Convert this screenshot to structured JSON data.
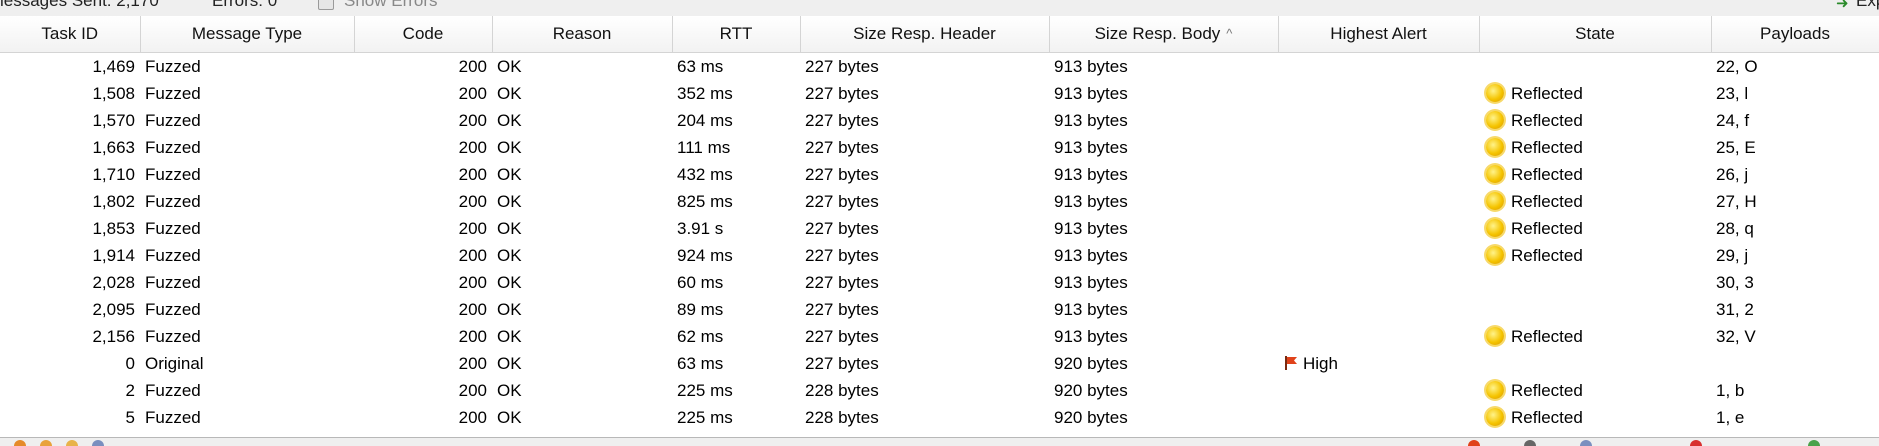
{
  "topbar": {
    "messages_sent": "lessages Sent: 2,170",
    "errors": "Errors: 0",
    "show_errors": "Show Errors",
    "export": "Exp"
  },
  "columns": [
    "Task ID",
    "Message Type",
    "Code",
    "Reason",
    "RTT",
    "Size Resp. Header",
    "Size Resp. Body",
    "Highest Alert",
    "State",
    "Payloads"
  ],
  "sorted_column": "Size Resp. Body",
  "rows": [
    {
      "task_id": "1,469",
      "message_type": "Fuzzed",
      "code": "200",
      "reason": "OK",
      "rtt": "63 ms",
      "size_header": "227 bytes",
      "size_body": "913 bytes",
      "alert": "",
      "state": "",
      "payloads": "22, O"
    },
    {
      "task_id": "1,508",
      "message_type": "Fuzzed",
      "code": "200",
      "reason": "OK",
      "rtt": "352 ms",
      "size_header": "227 bytes",
      "size_body": "913 bytes",
      "alert": "",
      "state": "Reflected",
      "payloads": "23, l"
    },
    {
      "task_id": "1,570",
      "message_type": "Fuzzed",
      "code": "200",
      "reason": "OK",
      "rtt": "204 ms",
      "size_header": "227 bytes",
      "size_body": "913 bytes",
      "alert": "",
      "state": "Reflected",
      "payloads": "24, f"
    },
    {
      "task_id": "1,663",
      "message_type": "Fuzzed",
      "code": "200",
      "reason": "OK",
      "rtt": "111 ms",
      "size_header": "227 bytes",
      "size_body": "913 bytes",
      "alert": "",
      "state": "Reflected",
      "payloads": "25, E"
    },
    {
      "task_id": "1,710",
      "message_type": "Fuzzed",
      "code": "200",
      "reason": "OK",
      "rtt": "432 ms",
      "size_header": "227 bytes",
      "size_body": "913 bytes",
      "alert": "",
      "state": "Reflected",
      "payloads": "26, j"
    },
    {
      "task_id": "1,802",
      "message_type": "Fuzzed",
      "code": "200",
      "reason": "OK",
      "rtt": "825 ms",
      "size_header": "227 bytes",
      "size_body": "913 bytes",
      "alert": "",
      "state": "Reflected",
      "payloads": "27, H"
    },
    {
      "task_id": "1,853",
      "message_type": "Fuzzed",
      "code": "200",
      "reason": "OK",
      "rtt": "3.91 s",
      "size_header": "227 bytes",
      "size_body": "913 bytes",
      "alert": "",
      "state": "Reflected",
      "payloads": "28, q"
    },
    {
      "task_id": "1,914",
      "message_type": "Fuzzed",
      "code": "200",
      "reason": "OK",
      "rtt": "924 ms",
      "size_header": "227 bytes",
      "size_body": "913 bytes",
      "alert": "",
      "state": "Reflected",
      "payloads": "29, j"
    },
    {
      "task_id": "2,028",
      "message_type": "Fuzzed",
      "code": "200",
      "reason": "OK",
      "rtt": "60 ms",
      "size_header": "227 bytes",
      "size_body": "913 bytes",
      "alert": "",
      "state": "",
      "payloads": "30, 3"
    },
    {
      "task_id": "2,095",
      "message_type": "Fuzzed",
      "code": "200",
      "reason": "OK",
      "rtt": "89 ms",
      "size_header": "227 bytes",
      "size_body": "913 bytes",
      "alert": "",
      "state": "",
      "payloads": "31, 2"
    },
    {
      "task_id": "2,156",
      "message_type": "Fuzzed",
      "code": "200",
      "reason": "OK",
      "rtt": "62 ms",
      "size_header": "227 bytes",
      "size_body": "913 bytes",
      "alert": "",
      "state": "Reflected",
      "payloads": "32, V"
    },
    {
      "task_id": "0",
      "message_type": "Original",
      "code": "200",
      "reason": "OK",
      "rtt": "63 ms",
      "size_header": "227 bytes",
      "size_body": "920 bytes",
      "alert": "High",
      "state": "",
      "payloads": ""
    },
    {
      "task_id": "2",
      "message_type": "Fuzzed",
      "code": "200",
      "reason": "OK",
      "rtt": "225 ms",
      "size_header": "228 bytes",
      "size_body": "920 bytes",
      "alert": "",
      "state": "Reflected",
      "payloads": "1, b"
    },
    {
      "task_id": "5",
      "message_type": "Fuzzed",
      "code": "200",
      "reason": "OK",
      "rtt": "225 ms",
      "size_header": "228 bytes",
      "size_body": "920 bytes",
      "alert": "",
      "state": "Reflected",
      "payloads": "1, e"
    }
  ],
  "icons": {
    "state_reflected": "sun-icon",
    "alert_high": "red-flag-icon",
    "sort": "sort-ascending-icon"
  },
  "colors": {
    "sun": "#f5c400",
    "flag": "#e0421a",
    "header_bg": "#f4f4f4"
  }
}
